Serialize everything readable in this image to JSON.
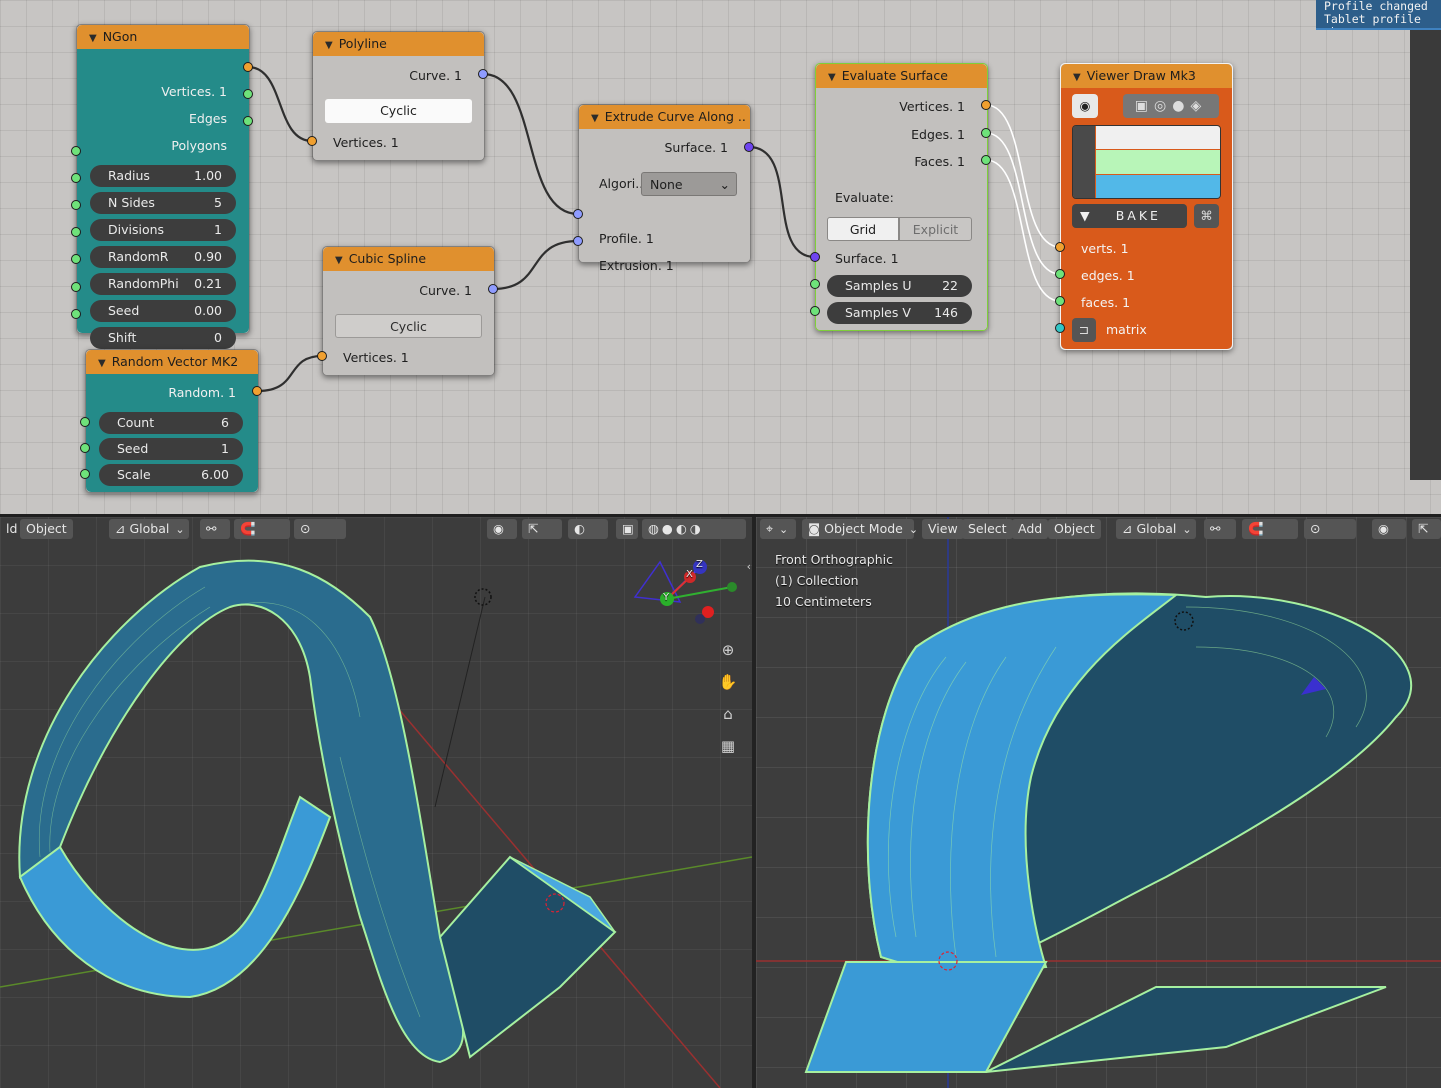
{
  "toast": {
    "line1": "Profile changed",
    "line2": "Tablet profile ch"
  },
  "nodes": {
    "ngon": {
      "title": "NGon",
      "outputs": [
        "Vertices. 1",
        "Edges",
        "Polygons"
      ],
      "fields": [
        {
          "label": "Radius",
          "value": "1.00"
        },
        {
          "label": "N Sides",
          "value": "5"
        },
        {
          "label": "Divisions",
          "value": "1"
        },
        {
          "label": "RandomR",
          "value": "0.90"
        },
        {
          "label": "RandomPhi",
          "value": "0.21"
        },
        {
          "label": "Seed",
          "value": "0.00"
        },
        {
          "label": "Shift",
          "value": "0"
        }
      ]
    },
    "polyline": {
      "title": "Polyline",
      "output": "Curve. 1",
      "toggle": "Cyclic",
      "input": "Vertices. 1"
    },
    "cubic_spline": {
      "title": "Cubic Spline",
      "output": "Curve. 1",
      "toggle": "Cyclic",
      "input": "Vertices. 1"
    },
    "random_vector": {
      "title": "Random Vector MK2",
      "output": "Random. 1",
      "fields": [
        {
          "label": "Count",
          "value": "6"
        },
        {
          "label": "Seed",
          "value": "1"
        },
        {
          "label": "Scale",
          "value": "6.00"
        }
      ]
    },
    "extrude": {
      "title": "Extrude Curve Along ..",
      "output": "Surface. 1",
      "algo_label": "Algori..",
      "algo_value": "None",
      "inputs": [
        "Profile. 1",
        "Extrusion. 1"
      ]
    },
    "evaluate": {
      "title": "Evaluate Surface",
      "outputs": [
        "Vertices. 1",
        "Edges. 1",
        "Faces. 1"
      ],
      "evaluate_label": "Evaluate:",
      "modes": [
        "Grid",
        "Explicit"
      ],
      "input": "Surface. 1",
      "fields": [
        {
          "label": "Samples U",
          "value": "22"
        },
        {
          "label": "Samples V",
          "value": "146"
        }
      ]
    },
    "viewer": {
      "title": "Viewer Draw Mk3",
      "bake": "BAKE",
      "inputs": [
        "verts. 1",
        "edges. 1",
        "faces. 1",
        "matrix"
      ],
      "colors": {
        "verts": "#f0f0f0",
        "edges": "#b8f5b8",
        "faces": "#52b8e8"
      }
    }
  },
  "left_viewport": {
    "menu": [
      "ld",
      "Object"
    ],
    "orientation": "Global",
    "gizmo": {
      "x": "X",
      "y": "Y",
      "z": "Z"
    }
  },
  "right_viewport": {
    "mode": "Object Mode",
    "menu": [
      "View",
      "Select",
      "Add",
      "Object"
    ],
    "orientation": "Global",
    "overlay_lines": [
      "Front Orthographic",
      "(1) Collection",
      "10 Centimeters"
    ]
  },
  "colors": {
    "node_orange": "#e0902e",
    "node_teal": "#248b89",
    "surface_blue": "#3a9ad6",
    "wire_green": "#a6f0a0"
  }
}
